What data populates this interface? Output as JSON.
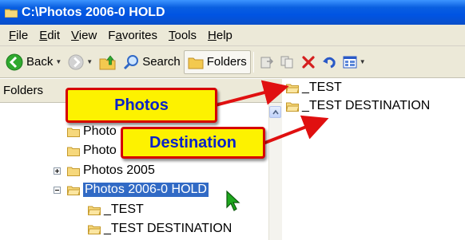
{
  "window": {
    "title": "C:\\Photos 2006-0 HOLD"
  },
  "menu": {
    "items": [
      {
        "key": "F",
        "rest": "ile"
      },
      {
        "key": "E",
        "rest": "dit"
      },
      {
        "key": "V",
        "rest": "iew"
      },
      {
        "pre": "F",
        "key": "a",
        "rest": "vorites"
      },
      {
        "key": "T",
        "rest": "ools"
      },
      {
        "key": "H",
        "rest": "elp"
      }
    ]
  },
  "toolbar": {
    "back_label": "Back",
    "search_label": "Search",
    "folders_label": "Folders"
  },
  "folders_pane": {
    "header": "Folders",
    "close_glyph": "×",
    "items": [
      {
        "label": "Photo"
      },
      {
        "label": "Photo"
      },
      {
        "label": "Photos 2005",
        "expander": "plus"
      },
      {
        "label": "Photos 2006-0 HOLD",
        "expander": "minus",
        "selected": true
      },
      {
        "label": "_TEST"
      },
      {
        "label": "_TEST DESTINATION"
      }
    ]
  },
  "content_pane": {
    "items": [
      {
        "label": "_TEST"
      },
      {
        "label": "_TEST DESTINATION"
      }
    ]
  },
  "callouts": {
    "photos": "Photos",
    "destination": "Destination"
  },
  "colors": {
    "selection": "#316ac5",
    "callout_fill": "#fdf200",
    "callout_border": "#d60000",
    "callout_text": "#0a22c8",
    "arrow": "#e01010"
  }
}
